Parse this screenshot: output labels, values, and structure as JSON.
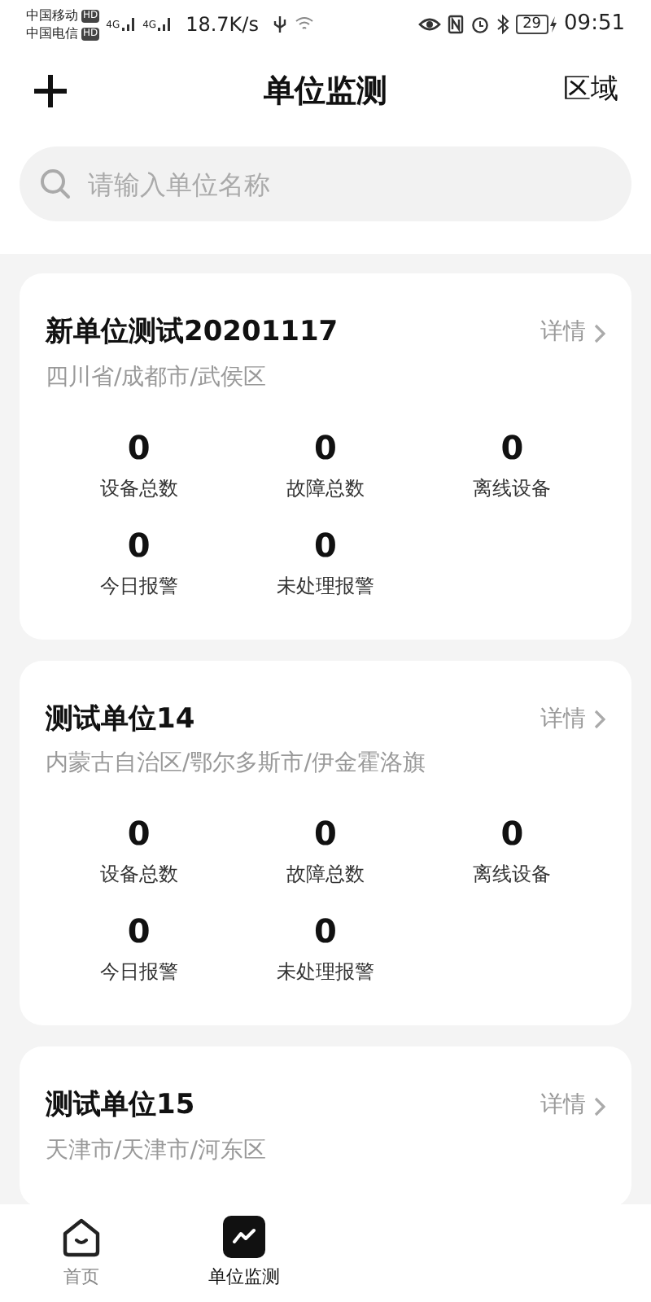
{
  "status_bar": {
    "carriers": [
      {
        "name": "中国移动",
        "badge": "HD"
      },
      {
        "name": "中国电信",
        "badge": "HD"
      }
    ],
    "signals": [
      {
        "network": "4G"
      },
      {
        "network": "4G"
      }
    ],
    "speed": "18.7K/s",
    "battery": "29",
    "time": "09:51"
  },
  "header": {
    "title": "单位监测",
    "right": "区域"
  },
  "search": {
    "placeholder": "请输入单位名称"
  },
  "units": [
    {
      "name": "新单位测试20201117",
      "detail": "详情",
      "address": "四川省/成都市/武侯区",
      "stats": [
        {
          "value": "0",
          "label": "设备总数"
        },
        {
          "value": "0",
          "label": "故障总数"
        },
        {
          "value": "0",
          "label": "离线设备"
        },
        {
          "value": "0",
          "label": "今日报警"
        },
        {
          "value": "0",
          "label": "未处理报警"
        }
      ]
    },
    {
      "name": "测试单位14",
      "detail": "详情",
      "address": "内蒙古自治区/鄂尔多斯市/伊金霍洛旗",
      "stats": [
        {
          "value": "0",
          "label": "设备总数"
        },
        {
          "value": "0",
          "label": "故障总数"
        },
        {
          "value": "0",
          "label": "离线设备"
        },
        {
          "value": "0",
          "label": "今日报警"
        },
        {
          "value": "0",
          "label": "未处理报警"
        }
      ]
    },
    {
      "name": "测试单位15",
      "detail": "详情",
      "address": "天津市/天津市/河东区"
    }
  ],
  "tabs": [
    {
      "label": "首页",
      "kind": "home",
      "selected": false
    },
    {
      "label": "单位监测",
      "kind": "monitor",
      "selected": true
    }
  ]
}
